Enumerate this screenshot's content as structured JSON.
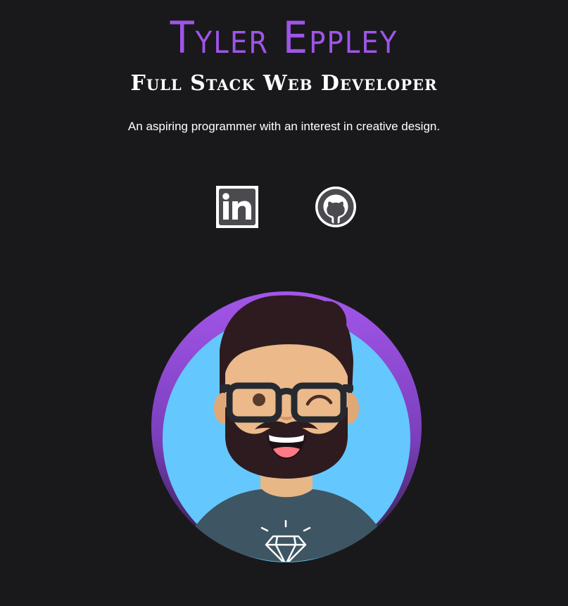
{
  "profile": {
    "name": "Tyler Eppley",
    "title": "Full Stack Web Developer",
    "tagline": "An aspiring programmer with an interest in creative design."
  },
  "social": [
    {
      "icon": "linkedin-icon"
    },
    {
      "icon": "github-icon"
    }
  ],
  "colors": {
    "background": "#19191b",
    "accent": "#9f55e8",
    "avatar_bg": "#64c8fe"
  }
}
